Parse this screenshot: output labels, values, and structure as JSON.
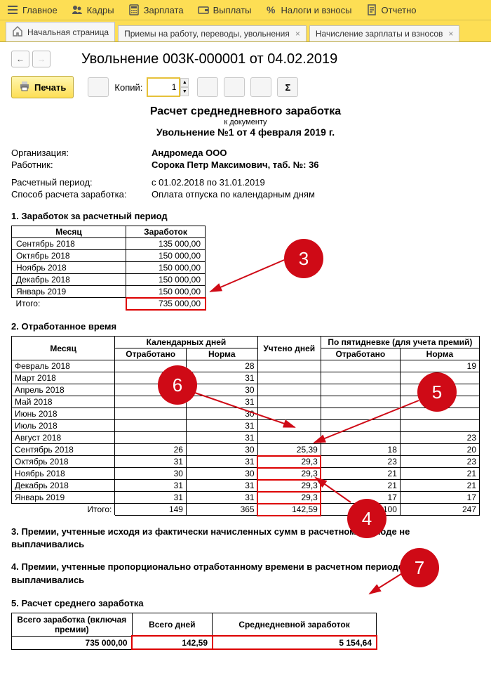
{
  "menu": {
    "main": "Главное",
    "kadry": "Кадры",
    "zarplata": "Зарплата",
    "vyplaty": "Выплаты",
    "nalogi": "Налоги и взносы",
    "otchetno": "Отчетно"
  },
  "tabs": {
    "home": "Начальная страница",
    "tab1": "Приемы на работу, переводы, увольнения",
    "tab2": "Начисление зарплаты и взносов",
    "close": "×"
  },
  "nav": {
    "back": "←",
    "fwd": "→"
  },
  "title": "Увольнение 003К-000001 от 04.02.2019",
  "toolbar": {
    "print": "Печать",
    "copies_label": "Копий:",
    "copies_value": "1"
  },
  "doc": {
    "title": "Расчет среднедневного заработка",
    "sub": "к документу",
    "title2": "Увольнение №1 от 4 февраля 2019 г.",
    "meta": {
      "org_l": "Организация:",
      "org_v": "Андромеда ООО",
      "emp_l": "Работник:",
      "emp_v": "Сорока Петр Максимович, таб. №: 36",
      "per_l": "Расчетный период:",
      "per_v": "с 01.02.2018 по 31.01.2019",
      "method_l": "Способ расчета заработка:",
      "method_v": "Оплата отпуска по календарным дням"
    },
    "s1": {
      "header": "1. Заработок за расчетный период",
      "th_month": "Месяц",
      "th_earn": "Заработок",
      "rows": [
        {
          "m": "Сентябрь 2018",
          "v": "135 000,00"
        },
        {
          "m": "Октябрь 2018",
          "v": "150 000,00"
        },
        {
          "m": "Ноябрь 2018",
          "v": "150 000,00"
        },
        {
          "m": "Декабрь 2018",
          "v": "150 000,00"
        },
        {
          "m": "Январь 2019",
          "v": "150 000,00"
        }
      ],
      "total_l": "Итого:",
      "total_v": "735 000,00"
    },
    "s2": {
      "header": "2. Отработанное время",
      "th_month": "Месяц",
      "th_cal": "Календарных дней",
      "th_uch": "Учтено дней",
      "th_5": "По пятидневке (для учета премий)",
      "th_otrab": "Отработано",
      "th_norma": "Норма",
      "rows": [
        {
          "m": "Февраль 2018",
          "co": "",
          "cn": "28",
          "u": "",
          "po": "",
          "pn": "19"
        },
        {
          "m": "Март 2018",
          "co": "",
          "cn": "31",
          "u": "",
          "po": "",
          "pn": ""
        },
        {
          "m": "Апрель 2018",
          "co": "",
          "cn": "30",
          "u": "",
          "po": "",
          "pn": ""
        },
        {
          "m": "Май 2018",
          "co": "",
          "cn": "31",
          "u": "",
          "po": "",
          "pn": ""
        },
        {
          "m": "Июнь 2018",
          "co": "",
          "cn": "30",
          "u": "",
          "po": "",
          "pn": ""
        },
        {
          "m": "Июль 2018",
          "co": "",
          "cn": "31",
          "u": "",
          "po": "",
          "pn": ""
        },
        {
          "m": "Август 2018",
          "co": "",
          "cn": "31",
          "u": "",
          "po": "",
          "pn": "23"
        },
        {
          "m": "Сентябрь 2018",
          "co": "26",
          "cn": "30",
          "u": "25,39",
          "po": "18",
          "pn": "20"
        },
        {
          "m": "Октябрь 2018",
          "co": "31",
          "cn": "31",
          "u": "29,3",
          "po": "23",
          "pn": "23"
        },
        {
          "m": "Ноябрь 2018",
          "co": "30",
          "cn": "30",
          "u": "29,3",
          "po": "21",
          "pn": "21"
        },
        {
          "m": "Декабрь 2018",
          "co": "31",
          "cn": "31",
          "u": "29,3",
          "po": "21",
          "pn": "21"
        },
        {
          "m": "Январь 2019",
          "co": "31",
          "cn": "31",
          "u": "29,3",
          "po": "17",
          "pn": "17"
        }
      ],
      "total_l": "Итого:",
      "totals": {
        "co": "149",
        "cn": "365",
        "u": "142,59",
        "po": "100",
        "pn": "247"
      }
    },
    "s3": "3. Премии, учтенные исходя из фактически начисленных сумм в расчетном периоде не выплачивались",
    "s4": "4. Премии, учтенные пропорционально отработанному времени в расчетном периоде не выплачивались",
    "s5": {
      "header": "5. Расчет среднего  заработка",
      "th1": "Всего заработка (включая премии)",
      "th2": "Всего дней",
      "th3": "Среднедневной заработок",
      "v1": "735 000,00",
      "v2": "142,59",
      "v3": "5 154,64"
    }
  },
  "callouts": {
    "c3": "3",
    "c4": "4",
    "c5": "5",
    "c6": "6",
    "c7": "7"
  }
}
